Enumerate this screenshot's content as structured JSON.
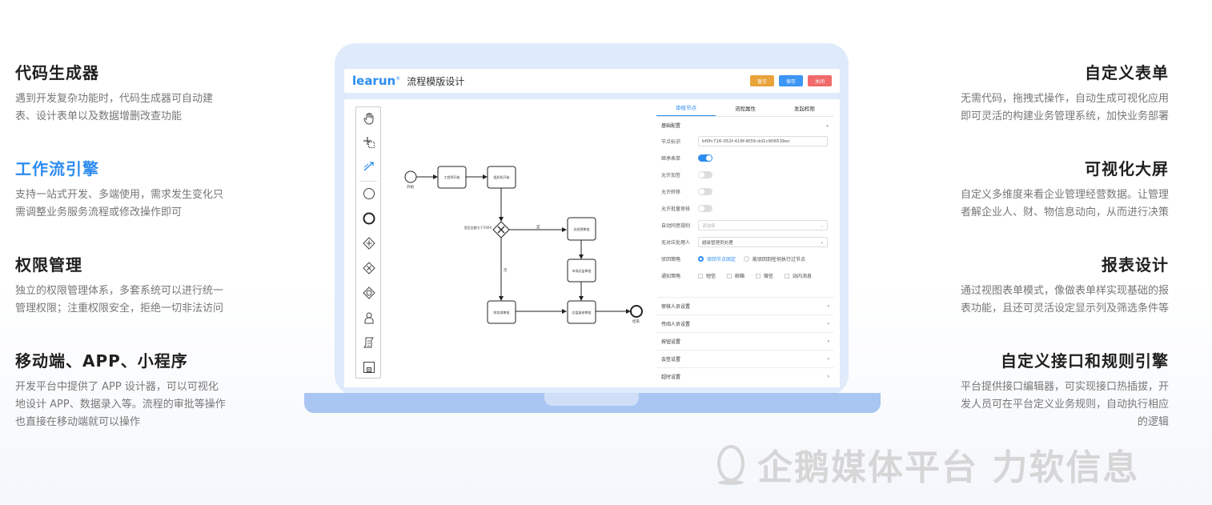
{
  "left_features": [
    {
      "title": "代码生成器",
      "desc": [
        "遇到开发复杂功能时，代码生成器可自动建",
        "表、设计表单以及数据增删改查功能"
      ],
      "highlight": false
    },
    {
      "title": "工作流引擎",
      "desc": [
        "支持一站式开发、多端使用，需求发生变化只",
        "需调整业务服务流程或修改操作即可"
      ],
      "highlight": true
    },
    {
      "title": "权限管理",
      "desc": [
        "独立的权限管理体系，多套系统可以进行统一",
        "管理权限；注重权限安全，拒绝一切非法访问"
      ],
      "highlight": false
    },
    {
      "title": "移动端、APP、小程序",
      "desc": [
        "开发平台中提供了 APP 设计器，可以可视化",
        "地设计 APP、数据录入等。流程的审批等操作",
        "也直接在移动端就可以操作"
      ],
      "highlight": false
    }
  ],
  "right_features": [
    {
      "title": "自定义表单",
      "desc": [
        "无需代码，拖拽式操作，自动生成可视化应用",
        "即可灵活的构建业务管理系统，加快业务部署"
      ]
    },
    {
      "title": "可视化大屏",
      "desc": [
        "自定义多维度来看企业管理经营数据。让管理",
        "者解企业人、财、物信息动向，从而进行决策"
      ]
    },
    {
      "title": "报表设计",
      "desc": [
        "通过视图表单模式，像做表单样实现基础的报",
        "表功能，且还可灵活设定显示列及筛选条件等"
      ]
    },
    {
      "title": "自定义接口和规则引擎",
      "desc": [
        "平台提供接口编辑器，可实现接口热插拔，开",
        "发人员可在平台定义业务规则，自动执行相应",
        "的逻辑"
      ]
    }
  ],
  "app": {
    "logo": "learun",
    "logo_mark": "®",
    "title": "流程模版设计",
    "buttons": [
      {
        "label": "暂存",
        "color": "#e8a33a"
      },
      {
        "label": "保存",
        "color": "#3d95f5"
      },
      {
        "label": "关闭",
        "color": "#f06a6a"
      }
    ]
  },
  "flow": {
    "start_label": "开始",
    "end_label": "结束",
    "nodes": [
      "工程师开始",
      "组织机开始",
      "总经理审批",
      "市场总监审批",
      "财务部审批",
      "总监复核审批"
    ],
    "gateway_label": "是否金额大于5000",
    "yes_label": "是",
    "no_label": "否"
  },
  "panel": {
    "tabs": [
      "审核节点",
      "流程属性",
      "发起权限"
    ],
    "section": "基础配置",
    "node_id_label": "节点标识",
    "node_id_value": "bf0fc716-052f-418f-8f39-dd1c906539ec",
    "switches": [
      {
        "label": "继承表单",
        "on": true
      },
      {
        "label": "允许加签",
        "on": false
      },
      {
        "label": "允许转移",
        "on": false
      },
      {
        "label": "允许批量审核",
        "on": false
      }
    ],
    "auto_rule_label": "自动同意规则",
    "auto_rule_placeholder": "请选择",
    "no_handler_label": "无对应处理人",
    "no_handler_value": "超级管理员处理",
    "reject_label": "驳回策略",
    "reject_opts": [
      "驳回节点固定",
      "能驳回到任何执行过节点"
    ],
    "notify_label": "通知策略",
    "notify_opts": [
      "短信",
      "邮箱",
      "微信",
      "站内消息"
    ],
    "collapsed": [
      "审核人员设置",
      "传阅人员设置",
      "按钮设置",
      "会签设置",
      "超时设置"
    ]
  },
  "watermark": "企鹅媒体平台 力软信息"
}
